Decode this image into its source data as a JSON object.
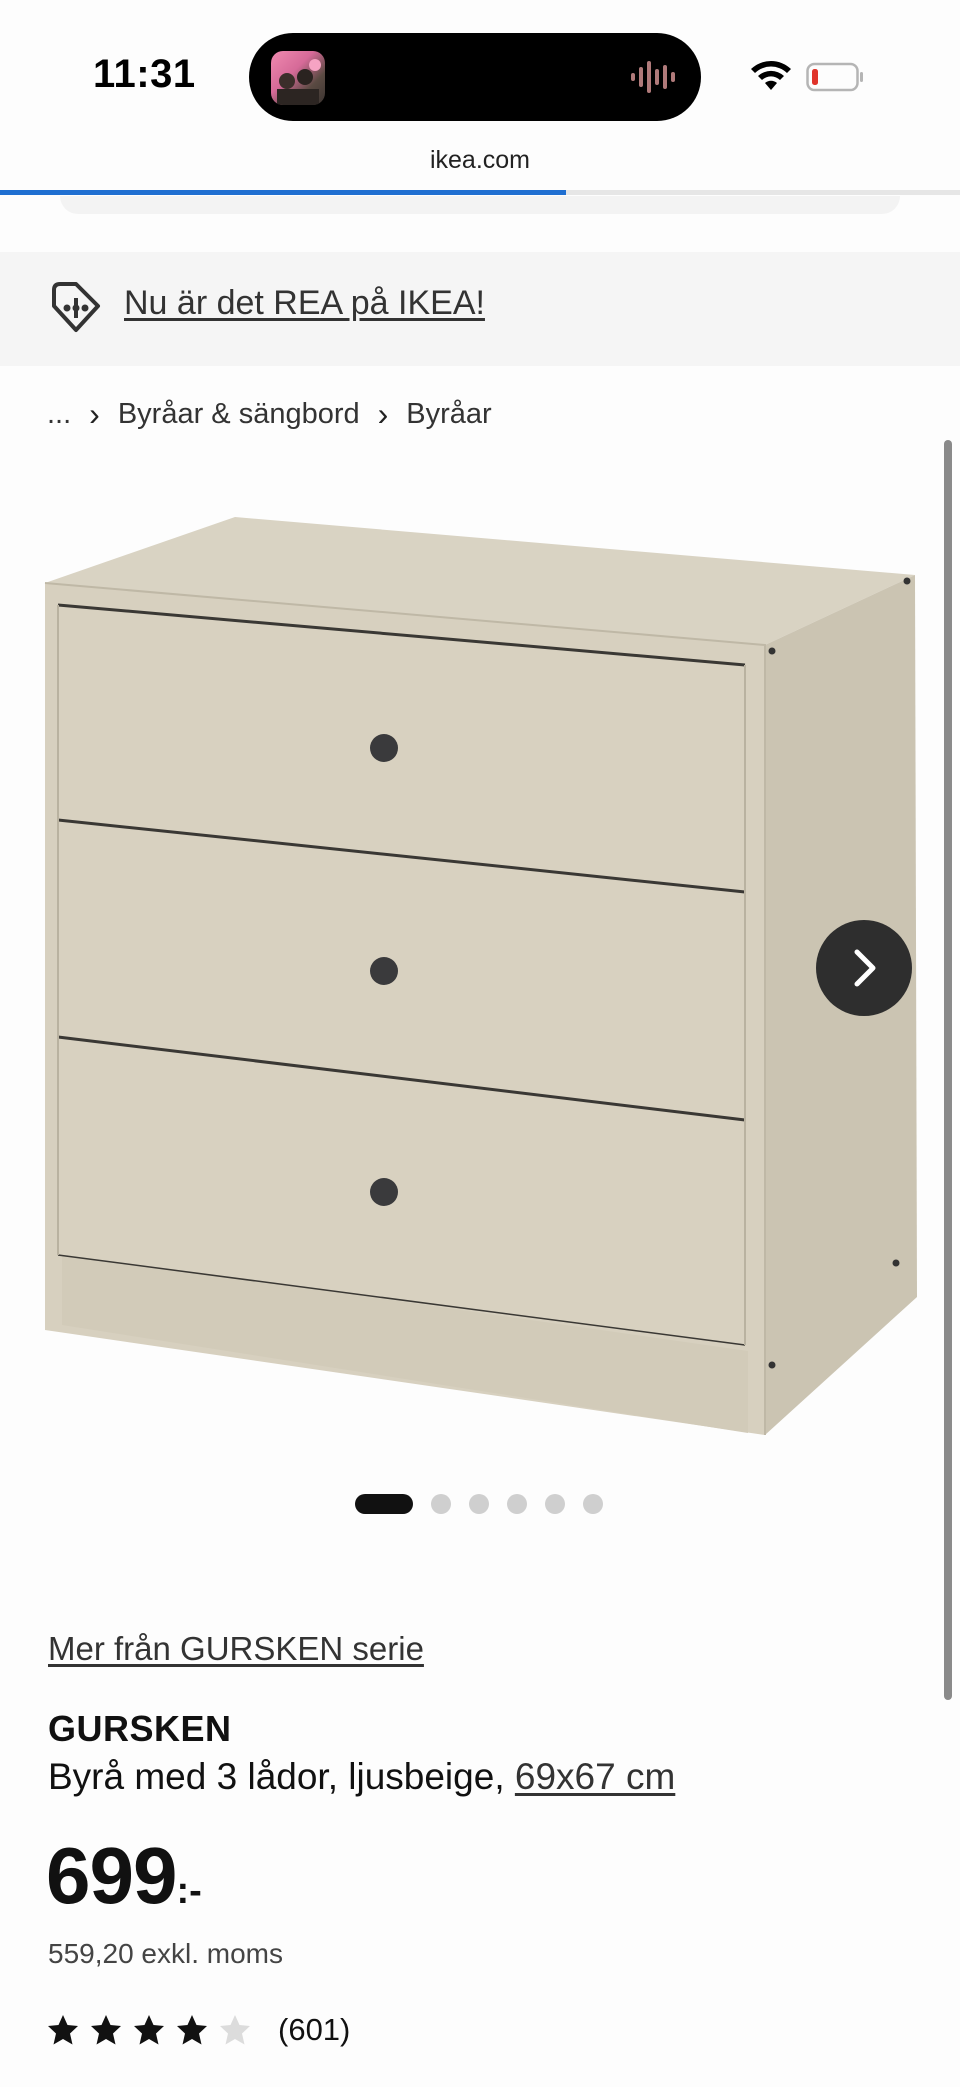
{
  "status_bar": {
    "time": "11:31",
    "battery_color": "#e0342b"
  },
  "browser": {
    "url": "ikea.com",
    "load_progress": 0.59,
    "progress_color": "#1f6fd1"
  },
  "promo": {
    "text": "Nu är det REA på IKEA!",
    "icon": "price-tag-icon"
  },
  "breadcrumb": {
    "items": [
      "...",
      "Byråar & sängbord",
      "Byråar"
    ],
    "separator_icon": "chevron-right-icon"
  },
  "gallery": {
    "image_count": 6,
    "active_index": 0,
    "next_icon": "chevron-right-icon",
    "product_color": "#d7d0bf"
  },
  "product": {
    "series_link": "Mer från GURSKEN serie",
    "name": "GURSKEN",
    "description": "Byrå med 3 lådor, ljusbeige,",
    "size_link": "69x67 cm",
    "price_integer": "699",
    "price_suffix": ":-",
    "price_ex_vat": "559,20 exkl. moms",
    "rating": 4,
    "rating_max": 5,
    "review_count": "(601)"
  }
}
